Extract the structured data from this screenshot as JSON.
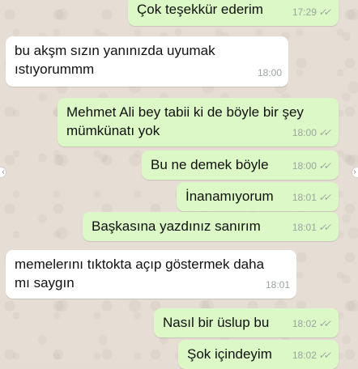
{
  "chat": {
    "messages": [
      {
        "dir": "out",
        "text": "Çok teşekkür ederim",
        "time": "17:29",
        "ticks": "✓✓"
      },
      {
        "dir": "in",
        "text": "bu akşm sızın yanınızda uyumak ıstıyorummm",
        "time": "18:00"
      },
      {
        "dir": "out",
        "text": "Mehmet Ali bey tabii ki de böyle bir şey mümkünatı yok",
        "time": "18:00",
        "ticks": "✓✓"
      },
      {
        "dir": "out",
        "text": "Bu ne demek böyle",
        "time": "18:00",
        "ticks": "✓✓"
      },
      {
        "dir": "out",
        "text": "İnanamıyorum",
        "time": "18:01",
        "ticks": "✓✓"
      },
      {
        "dir": "out",
        "text": "Başkasına yazdınız sanırım",
        "time": "18:01",
        "ticks": "✓✓"
      },
      {
        "dir": "in",
        "text": "memelerını tıktokta açıp göstermek daha mı saygın",
        "time": "18:01"
      },
      {
        "dir": "out",
        "text": "Nasıl bir üslup bu",
        "time": "18:02",
        "ticks": "✓✓"
      },
      {
        "dir": "out",
        "text": "Şok içindeyim",
        "time": "18:02",
        "ticks": "✓✓"
      }
    ]
  },
  "nav": {
    "prev_icon": "chevron-left-icon",
    "next_icon": "chevron-right-icon",
    "prev_glyph": "‹",
    "next_glyph": "›"
  },
  "colors": {
    "outgoing_bubble": "#dcf8c6",
    "incoming_bubble": "#ffffff",
    "wallpaper": "#e6ded4",
    "meta_text": "#9aa3a0"
  }
}
